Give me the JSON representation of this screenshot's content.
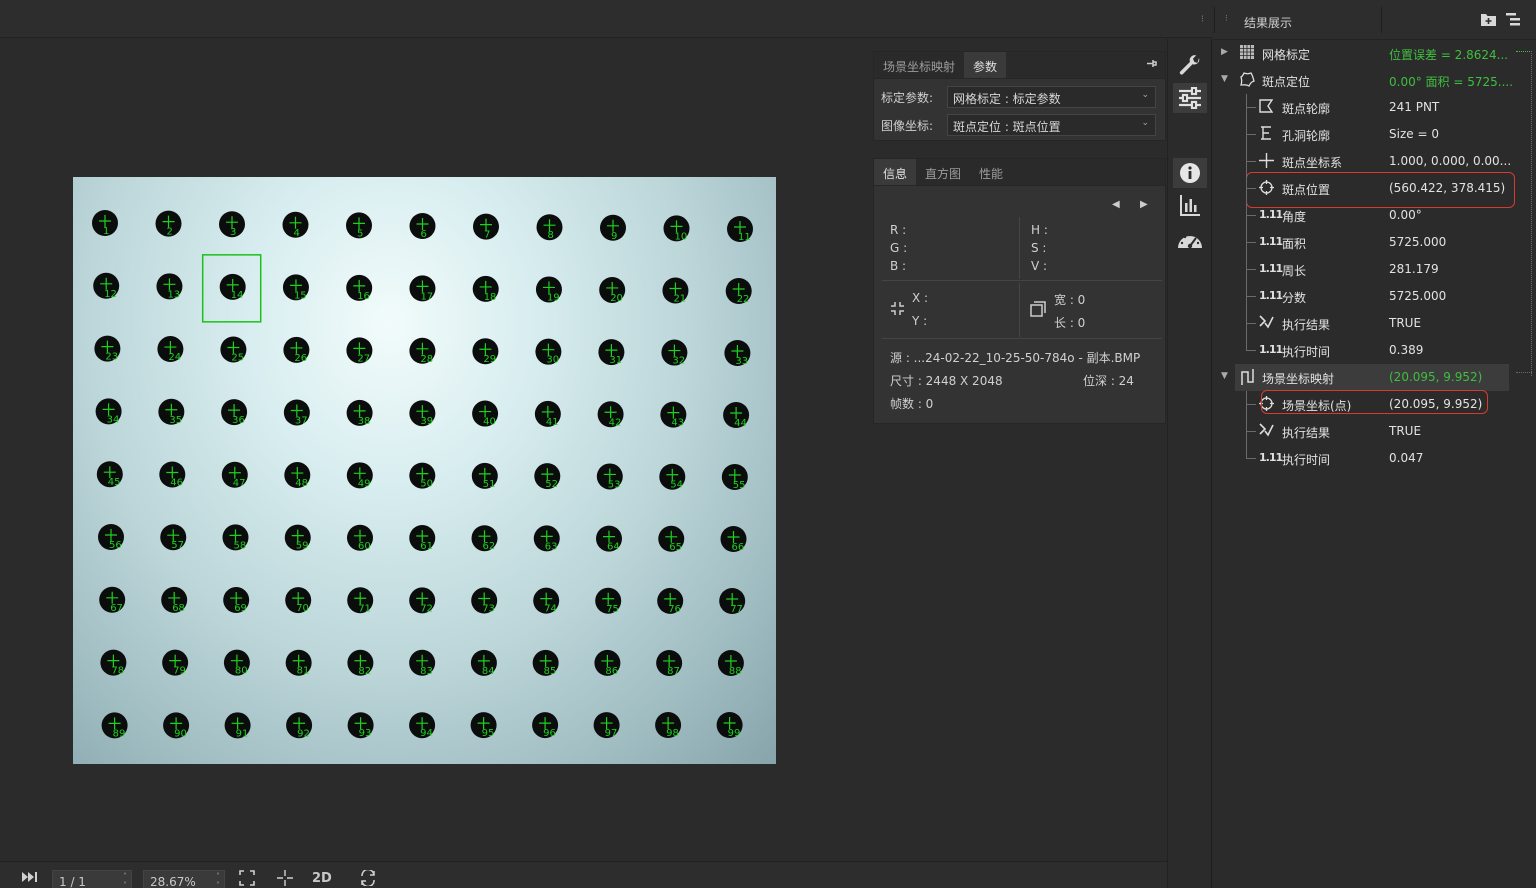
{
  "bottom": {
    "frame": "1 / 1",
    "zoom": "28.67%",
    "mode_2d": "2D"
  },
  "params_panel": {
    "tabs": [
      {
        "label": "场景坐标映射",
        "active": false
      },
      {
        "label": "参数",
        "active": true
      }
    ],
    "rows": [
      {
        "label": "标定参数:",
        "value": "网格标定 : 标定参数"
      },
      {
        "label": "图像坐标:",
        "value": "斑点定位 : 斑点位置"
      }
    ]
  },
  "info_panel": {
    "tabs": [
      {
        "label": "信息",
        "active": true
      },
      {
        "label": "直方图",
        "active": false
      },
      {
        "label": "性能",
        "active": false
      }
    ],
    "rgb": [
      "R :",
      "G :",
      "B :"
    ],
    "hsv": [
      "H :",
      "S :",
      "V :"
    ],
    "xy": [
      "X :",
      "Y :"
    ],
    "wh": [
      "宽 : 0",
      "长 : 0"
    ],
    "source": "源    : ...24-02-22_10-25-50-784o - 副本.BMP",
    "size": "尺寸 : 2448 X 2048",
    "depth": "位深 : 24",
    "frames": "帧数 : 0"
  },
  "results": {
    "title": "结果展示",
    "rows": [
      {
        "name": "网格标定",
        "value": "位置误差 = 2.8624...",
        "value_color": "green",
        "icon": "grid-icon",
        "level": 0,
        "arrow": "right"
      },
      {
        "name": "斑点定位",
        "value": "0.00° 面积 = 5725....",
        "value_color": "green",
        "icon": "blob-icon",
        "level": 0,
        "arrow": "down"
      },
      {
        "name": "斑点轮廓",
        "value": "241 PNT",
        "icon": "contour-icon",
        "level": 1
      },
      {
        "name": "孔洞轮廓",
        "value": "Size = 0",
        "icon": "hole-contour-icon",
        "level": 1
      },
      {
        "name": "斑点坐标系",
        "value": "1.000, 0.000, 0.00...",
        "icon": "axis-icon",
        "level": 1
      },
      {
        "name": "斑点位置",
        "value": "(560.422, 378.415)",
        "icon": "crosshair-icon",
        "level": 1,
        "highlight": true
      },
      {
        "name": "角度",
        "value": "0.00°",
        "icon": "number-icon",
        "level": 1
      },
      {
        "name": "面积",
        "value": "5725.000",
        "icon": "number-icon",
        "level": 1
      },
      {
        "name": "周长",
        "value": "281.179",
        "icon": "number-icon",
        "level": 1
      },
      {
        "name": "分数",
        "value": "5725.000",
        "icon": "number-icon",
        "level": 1
      },
      {
        "name": "执行结果",
        "value": "TRUE",
        "icon": "check-icon",
        "level": 1
      },
      {
        "name": "执行时间",
        "value": "0.389",
        "icon": "number-icon",
        "level": 1
      },
      {
        "name": "场景坐标映射",
        "value": "(20.095, 9.952)",
        "value_color": "green",
        "icon": "mapping-icon",
        "level": 0,
        "arrow": "down",
        "selected": true
      },
      {
        "name": "场景坐标(点)",
        "value": "(20.095, 9.952)",
        "icon": "crosshair-icon",
        "level": 1,
        "highlight": true
      },
      {
        "name": "执行结果",
        "value": "TRUE",
        "icon": "check-icon",
        "level": 1
      },
      {
        "name": "执行时间",
        "value": "0.047",
        "icon": "number-icon",
        "level": 1
      }
    ]
  },
  "image": {
    "dot_labels": [
      "1",
      "2",
      "3",
      "4",
      "5",
      "6",
      "7",
      "8",
      "9",
      "10",
      "11",
      "12",
      "13",
      "14",
      "15",
      "16",
      "17",
      "18",
      "19",
      "20",
      "21",
      "22",
      "23",
      "24",
      "25",
      "26",
      "27",
      "28",
      "29",
      "30",
      "31",
      "32",
      "33",
      "34",
      "35",
      "36",
      "37",
      "38",
      "39",
      "40",
      "41",
      "42",
      "43",
      "44",
      "45",
      "46",
      "47",
      "48",
      "49",
      "50",
      "51",
      "52",
      "53",
      "54",
      "55",
      "56",
      "57",
      "58",
      "59",
      "60",
      "61",
      "62",
      "63",
      "64",
      "65",
      "66",
      "67",
      "68",
      "69",
      "70",
      "71",
      "72",
      "73",
      "74",
      "75",
      "76",
      "77",
      "78",
      "79",
      "80",
      "81",
      "82",
      "83",
      "84",
      "85",
      "86",
      "87",
      "88",
      "89",
      "90",
      "91",
      "92",
      "93",
      "94",
      "95",
      "96",
      "97",
      "98",
      "99"
    ],
    "selected_label": "14",
    "marker_color": "#1fd11f"
  }
}
